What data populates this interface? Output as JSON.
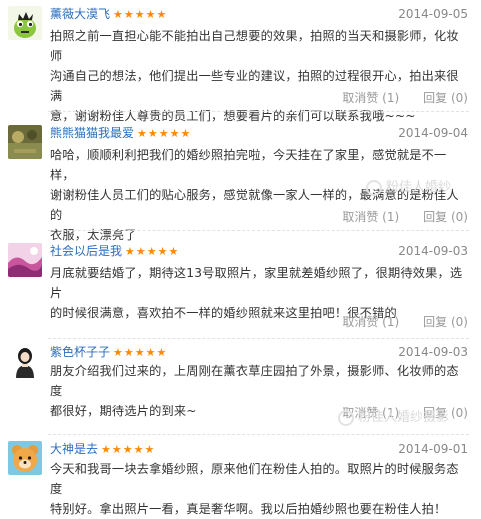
{
  "reviews": [
    {
      "username": "薰薇大漠飞",
      "stars": "★★★★★",
      "date": "2014-09-05",
      "avatar": "green-cartoon-avatar",
      "lines": [
        "拍照之前一直担心能不能拍出自己想要的效果，拍照的当天和摄影师，化妆师",
        "沟通自己的想法，他们提出一些专业的建议，拍照的过程很开心，拍出来很满",
        "意，谢谢粉佳人尊贵的员工们，想要看片的亲们可以联系我哦~~~"
      ],
      "cancel_like": "取消赞 (1)",
      "reply": "回复 (0)"
    },
    {
      "username": "熊熊猫猫我最爱",
      "stars": "★★★★★",
      "date": "2014-09-04",
      "avatar": "olive-photo-avatar",
      "lines": [
        "哈哈，顺顺利利把我们的婚纱照拍完啦，今天挂在了家里，感觉就是不一样，",
        "谢谢粉佳人员工们的贴心服务，感觉就像一家人一样的，最满意的是粉佳人的",
        "衣服，太漂亮了"
      ],
      "cancel_like": "取消赞 (1)",
      "reply": "回复 (0)"
    },
    {
      "username": "社会以后是我",
      "stars": "★★★★★",
      "date": "2014-09-03",
      "avatar": "pink-purple-avatar",
      "lines": [
        "月底就要结婚了，期待这13号取照片，家里就差婚纱照了，很期待效果，选片",
        "的时候很满意，喜欢拍不一样的婚纱照就来这里拍吧！很不错的"
      ],
      "cancel_like": "取消赞 (1)",
      "reply": "回复 (0)"
    },
    {
      "username": "紫色杯子子",
      "stars": "★★★★★",
      "date": "2014-09-03",
      "avatar": "girl-portrait-avatar",
      "lines": [
        "朋友介绍我们过来的，上周刚在薰衣草庄园拍了外景，摄影师、化妆师的态度",
        "都很好，期待选片的到来~"
      ],
      "cancel_like": "取消赞 (1)",
      "reply": "回复 (0)"
    },
    {
      "username": "大神是去",
      "stars": "★★★★★",
      "date": "2014-09-01",
      "avatar": "orange-bear-avatar",
      "lines": [
        "今天和我哥一块去拿婚纱照，原来他们在粉佳人拍的。取照片的时候服务态度",
        "特别好。拿出照片一看，真是奢华啊。我以后拍婚纱照也要在粉佳人拍！"
      ]
    }
  ],
  "watermarks": [
    "粉佳人婚纱",
    "粉佳人婚纱摄影"
  ]
}
